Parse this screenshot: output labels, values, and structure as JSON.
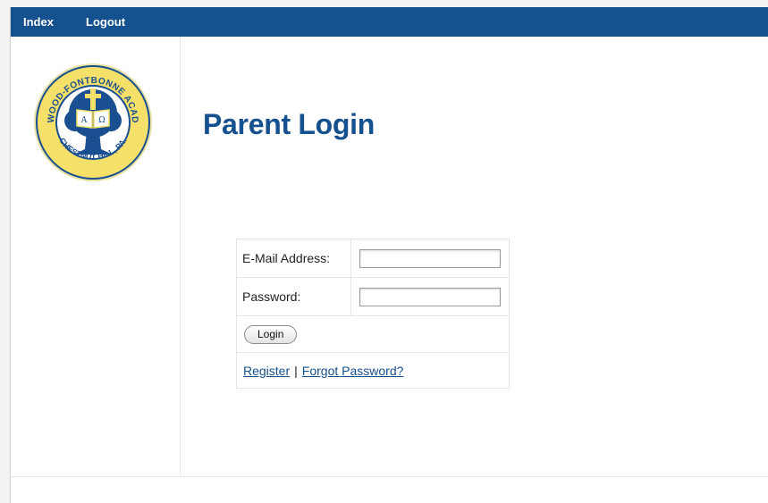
{
  "nav": {
    "index_label": "Index",
    "logout_label": "Logout"
  },
  "logo": {
    "text_top": "NORWOOD-FONTBONNE ACADEMY",
    "text_bottom": "CHESTNUT HILL, PA.",
    "colors": {
      "ring": "#f5e06a",
      "blue": "#1a4f91",
      "white": "#ffffff"
    }
  },
  "page": {
    "title": "Parent Login"
  },
  "form": {
    "email_label": "E-Mail Address:",
    "email_value": "",
    "password_label": "Password:",
    "password_value": "",
    "login_button": "Login",
    "register_link": "Register",
    "separator": "|",
    "forgot_link": "Forgot Password?"
  },
  "colors": {
    "brand_blue": "#15508f",
    "background": "#ffffff"
  }
}
